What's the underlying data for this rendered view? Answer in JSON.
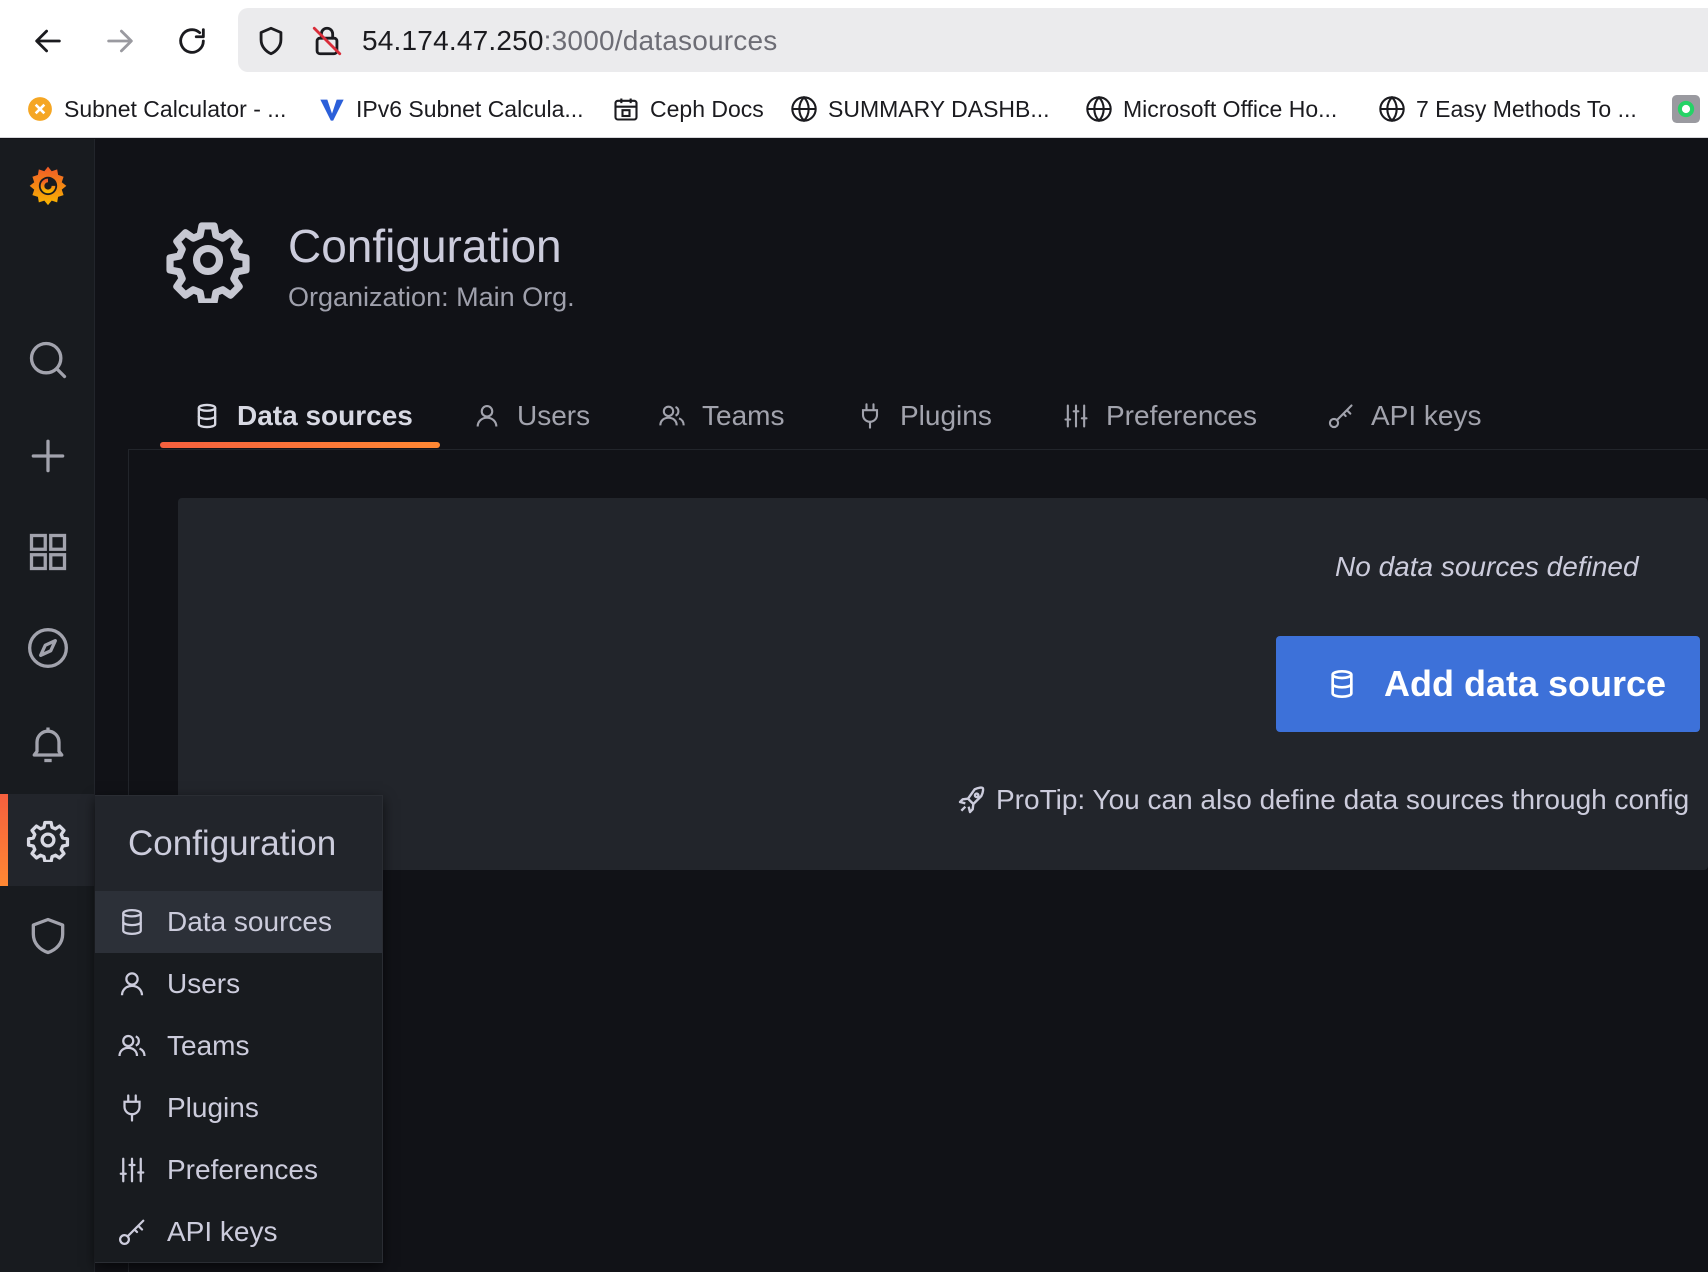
{
  "browser": {
    "url_host": "54.174.47.250",
    "url_path": ":3000/datasources",
    "bookmarks": [
      {
        "label": "Subnet Calculator - ...",
        "icon": "subnet-calc-icon"
      },
      {
        "label": "IPv6 Subnet Calcula...",
        "icon": "ipv6-icon"
      },
      {
        "label": "Ceph Docs",
        "icon": "ceph-icon"
      },
      {
        "label": "SUMMARY DASHB...",
        "icon": "globe-icon"
      },
      {
        "label": "Microsoft Office Ho...",
        "icon": "globe-icon"
      },
      {
        "label": "7 Easy Methods To ...",
        "icon": "globe-icon"
      }
    ]
  },
  "sidebar": {
    "items": [
      "grafana-logo",
      "search-icon",
      "plus-icon",
      "dashboards-icon",
      "explore-icon",
      "alerting-bell-icon",
      "configuration-gear-icon",
      "shield-icon"
    ],
    "active": "configuration-gear-icon"
  },
  "header": {
    "title": "Configuration",
    "subtitle": "Organization: Main Org."
  },
  "tabs": [
    {
      "label": "Data sources",
      "icon": "database-icon",
      "active": true
    },
    {
      "label": "Users",
      "icon": "user-icon",
      "active": false
    },
    {
      "label": "Teams",
      "icon": "users-icon",
      "active": false
    },
    {
      "label": "Plugins",
      "icon": "plug-icon",
      "active": false
    },
    {
      "label": "Preferences",
      "icon": "sliders-icon",
      "active": false
    },
    {
      "label": "API keys",
      "icon": "key-icon",
      "active": false
    }
  ],
  "empty_state": {
    "title": "No data sources defined",
    "button_label": "Add data source",
    "protip": "ProTip: You can also define data sources through config"
  },
  "dropdown": {
    "title": "Configuration",
    "items": [
      {
        "label": "Data sources",
        "active": true
      },
      {
        "label": "Users",
        "active": false
      },
      {
        "label": "Teams",
        "active": false
      },
      {
        "label": "Plugins",
        "active": false
      },
      {
        "label": "Preferences",
        "active": false
      },
      {
        "label": "API keys",
        "active": false
      }
    ]
  },
  "colors": {
    "accent_orange": "#f55f3e",
    "primary_blue": "#3d71d9",
    "background": "#111217",
    "panel": "#22252b"
  }
}
